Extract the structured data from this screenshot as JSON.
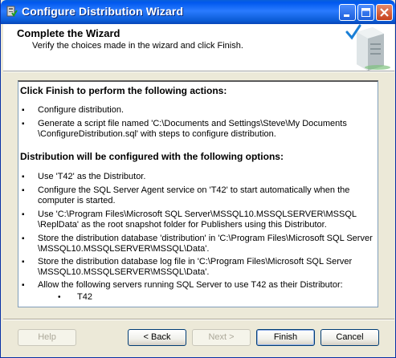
{
  "window": {
    "title": "Configure Distribution Wizard"
  },
  "header": {
    "title": "Complete the Wizard",
    "subtitle": "Verify the choices made in the wizard and click Finish."
  },
  "summary": {
    "section1_heading": "Click Finish to perform the following actions:",
    "actions": [
      {
        "lines": [
          "Configure distribution."
        ]
      },
      {
        "lines": [
          "Generate a script file named 'C:\\Documents and Settings\\Steve\\My Documents",
          "\\ConfigureDistribution.sql' with steps to configure distribution."
        ]
      }
    ],
    "section2_heading": "Distribution will be configured with the following options:",
    "options": [
      {
        "lines": [
          "Use 'T42' as the Distributor."
        ]
      },
      {
        "lines": [
          "Configure the SQL Server Agent service on 'T42' to start automatically when the",
          "computer is started."
        ]
      },
      {
        "lines": [
          "Use 'C:\\Program Files\\Microsoft SQL Server\\MSSQL10.MSSQLSERVER\\MSSQL",
          "\\ReplData' as the root snapshot folder for Publishers using this Distributor."
        ]
      },
      {
        "lines": [
          "Store the distribution database 'distribution' in 'C:\\Program Files\\Microsoft SQL Server",
          "\\MSSQL10.MSSQLSERVER\\MSSQL\\Data'."
        ]
      },
      {
        "lines": [
          "Store the distribution database log file in 'C:\\Program Files\\Microsoft SQL Server",
          "\\MSSQL10.MSSQLSERVER\\MSSQL\\Data'."
        ]
      },
      {
        "lines": [
          "Allow the following servers running SQL Server to use T42 as their Distributor:"
        ]
      }
    ],
    "servers": [
      "T42"
    ]
  },
  "buttons": {
    "help": "Help",
    "back": "< Back",
    "next": "Next >",
    "finish": "Finish",
    "cancel": "Cancel"
  },
  "colors": {
    "title_bar": "#0058ee",
    "dialog_bg": "#ece9d8",
    "close_button": "#c6401b"
  },
  "icons": {
    "title": "wizard-app-icon",
    "header": "server-check-icon",
    "minimize": "minimize-icon",
    "maximize": "maximize-icon",
    "close": "close-icon"
  }
}
